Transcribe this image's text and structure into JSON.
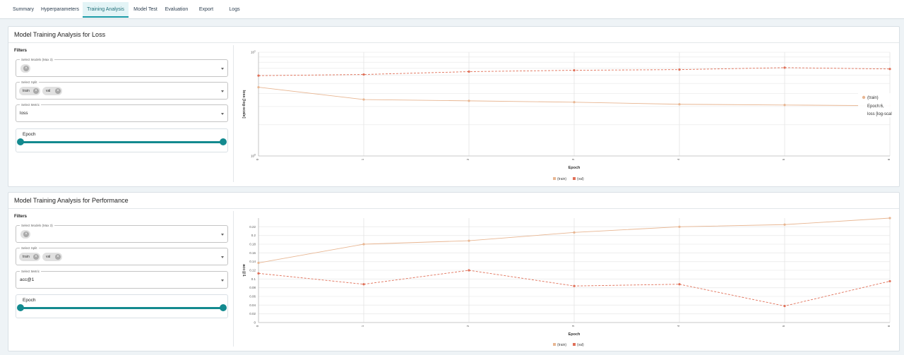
{
  "tabs": [
    {
      "label": "Summary",
      "active": false
    },
    {
      "label": "Hyperparameters",
      "active": false
    },
    {
      "label": "Training Analysis",
      "active": true
    },
    {
      "label": "Model Test",
      "active": false
    },
    {
      "label": "Evaluation",
      "active": false
    },
    {
      "label": "Export",
      "active": false
    },
    {
      "label": "Logs",
      "active": false
    }
  ],
  "loss_panel": {
    "title": "Model Training Analysis for Loss",
    "filters_label": "Filters",
    "models_legend": "Select Models (Max 3)",
    "split_legend": "Select Split",
    "split_chips": [
      "train",
      "val"
    ],
    "metric_legend": "Select Metric",
    "metric_value": "loss",
    "epoch_label": "Epoch",
    "epoch_range": [
      0,
      6
    ],
    "tooltip": {
      "series": "(train)",
      "line1": "Epoch:6,",
      "line2": "loss [log-scal"
    }
  },
  "perf_panel": {
    "title": "Model Training Analysis for Performance",
    "filters_label": "Filters",
    "models_legend": "Select Models (Max 3)",
    "split_legend": "Select Split",
    "split_chips": [
      "train",
      "val"
    ],
    "metric_legend": "Select Metric",
    "metric_value": "acc@1",
    "epoch_label": "Epoch",
    "epoch_range": [
      0,
      6
    ]
  },
  "chart_data": [
    {
      "type": "line",
      "x": [
        0,
        1,
        2,
        3,
        4,
        5,
        6
      ],
      "xlabel": "Epoch",
      "ylabel": "loss [log-scale]",
      "y_scale": "log",
      "ylim": [
        1,
        10
      ],
      "ytick_labels": [
        "10^1",
        "10^0"
      ],
      "xtick_labels": [
        "0",
        "1",
        "2",
        "3",
        "4",
        "5",
        "6"
      ],
      "grid": true,
      "legend_position": "bottom-center",
      "series": [
        {
          "name": "(train)",
          "color": "#e8b692",
          "dashed": false,
          "values": [
            4.6,
            3.5,
            3.4,
            3.3,
            3.15,
            3.1,
            3.05
          ]
        },
        {
          "name": "(val)",
          "color": "#e07058",
          "dashed": true,
          "values": [
            5.95,
            6.1,
            6.5,
            6.7,
            6.8,
            7.1,
            6.9
          ]
        }
      ]
    },
    {
      "type": "line",
      "x": [
        0,
        1,
        2,
        3,
        4,
        5,
        6
      ],
      "xlabel": "Epoch",
      "ylabel": "acc@1",
      "ylim": [
        0,
        0.24
      ],
      "yticks": [
        0,
        0.02,
        0.04,
        0.06,
        0.08,
        0.1,
        0.12,
        0.14,
        0.16,
        0.18,
        0.2,
        0.22
      ],
      "ytick_labels": [
        "0",
        "0.02",
        "0.04",
        "0.06",
        "0.08",
        "0.1",
        "0.12",
        "0.14",
        "0.16",
        "0.18",
        "0.2",
        "0.22"
      ],
      "xtick_labels": [
        "0",
        "1",
        "2",
        "3",
        "4",
        "5",
        "6"
      ],
      "grid": true,
      "legend_position": "bottom-center",
      "series": [
        {
          "name": "(train)",
          "color": "#e8b692",
          "dashed": false,
          "values": [
            0.137,
            0.18,
            0.188,
            0.207,
            0.22,
            0.225,
            0.24
          ]
        },
        {
          "name": "(val)",
          "color": "#e07058",
          "dashed": true,
          "values": [
            0.113,
            0.088,
            0.12,
            0.084,
            0.088,
            0.038,
            0.095
          ]
        }
      ]
    }
  ]
}
